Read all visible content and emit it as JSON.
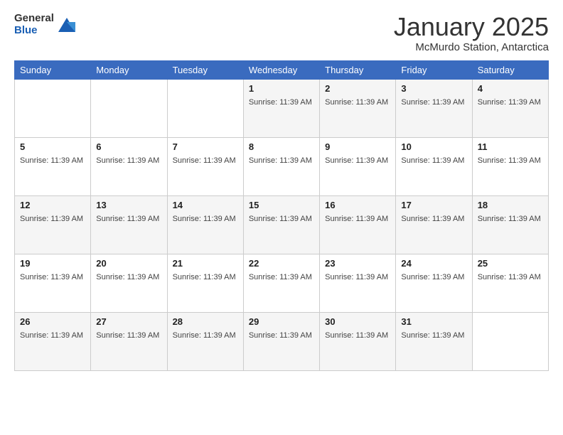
{
  "logo": {
    "line1": "General",
    "line2": "Blue"
  },
  "title": "January 2025",
  "location": "McMurdo Station, Antarctica",
  "days_of_week": [
    "Sunday",
    "Monday",
    "Tuesday",
    "Wednesday",
    "Thursday",
    "Friday",
    "Saturday"
  ],
  "sunrise_text": "Sunrise: 11:39 AM",
  "weeks": [
    [
      {
        "day": "",
        "sunrise": false
      },
      {
        "day": "",
        "sunrise": false
      },
      {
        "day": "",
        "sunrise": false
      },
      {
        "day": "1",
        "sunrise": true
      },
      {
        "day": "2",
        "sunrise": true
      },
      {
        "day": "3",
        "sunrise": true
      },
      {
        "day": "4",
        "sunrise": true
      }
    ],
    [
      {
        "day": "5",
        "sunrise": true
      },
      {
        "day": "6",
        "sunrise": true
      },
      {
        "day": "7",
        "sunrise": true
      },
      {
        "day": "8",
        "sunrise": true
      },
      {
        "day": "9",
        "sunrise": true
      },
      {
        "day": "10",
        "sunrise": true
      },
      {
        "day": "11",
        "sunrise": true
      }
    ],
    [
      {
        "day": "12",
        "sunrise": true
      },
      {
        "day": "13",
        "sunrise": true
      },
      {
        "day": "14",
        "sunrise": true
      },
      {
        "day": "15",
        "sunrise": true
      },
      {
        "day": "16",
        "sunrise": true
      },
      {
        "day": "17",
        "sunrise": true
      },
      {
        "day": "18",
        "sunrise": true
      }
    ],
    [
      {
        "day": "19",
        "sunrise": true
      },
      {
        "day": "20",
        "sunrise": true
      },
      {
        "day": "21",
        "sunrise": true
      },
      {
        "day": "22",
        "sunrise": true
      },
      {
        "day": "23",
        "sunrise": true
      },
      {
        "day": "24",
        "sunrise": true
      },
      {
        "day": "25",
        "sunrise": true
      }
    ],
    [
      {
        "day": "26",
        "sunrise": true
      },
      {
        "day": "27",
        "sunrise": true
      },
      {
        "day": "28",
        "sunrise": true
      },
      {
        "day": "29",
        "sunrise": true
      },
      {
        "day": "30",
        "sunrise": true
      },
      {
        "day": "31",
        "sunrise": true
      },
      {
        "day": "",
        "sunrise": false
      }
    ]
  ]
}
